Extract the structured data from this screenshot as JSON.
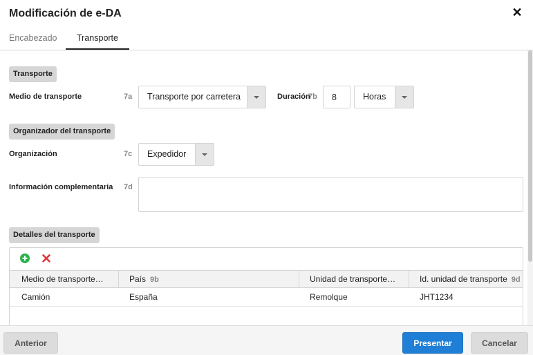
{
  "dialog": {
    "title": "Modificación de e-DA"
  },
  "tabs": [
    {
      "label": "Encabezado",
      "active": false
    },
    {
      "label": "Transporte",
      "active": true
    }
  ],
  "sections": {
    "transporte": "Transporte",
    "organizador": "Organizador del transporte",
    "detalles": "Detalles del transporte"
  },
  "fields": {
    "medio": {
      "label": "Medio de transporte",
      "code": "7a",
      "value": "Transporte por carretera"
    },
    "duracion": {
      "label": "Duración",
      "code": "7b",
      "value": "8",
      "unit": "Horas"
    },
    "organizacion": {
      "label": "Organización",
      "code": "7c",
      "value": "Expedidor"
    },
    "info": {
      "label": "Información complementaria",
      "code": "7d",
      "value": ""
    }
  },
  "grid": {
    "columns": [
      {
        "label": "Medio de transporte…",
        "code": ""
      },
      {
        "label": "País",
        "code": "9b"
      },
      {
        "label": "Unidad de transporte…",
        "code": ""
      },
      {
        "label": "Id. unidad de transporte",
        "code": "9d"
      }
    ],
    "rows": [
      [
        "Camión",
        "España",
        "Remolque",
        "JHT1234"
      ]
    ]
  },
  "footer": {
    "back": "Anterior",
    "submit": "Presentar",
    "cancel": "Cancelar"
  },
  "colors": {
    "primary": "#1f7fd6",
    "add": "#2bb24c",
    "delete": "#e0343a"
  }
}
